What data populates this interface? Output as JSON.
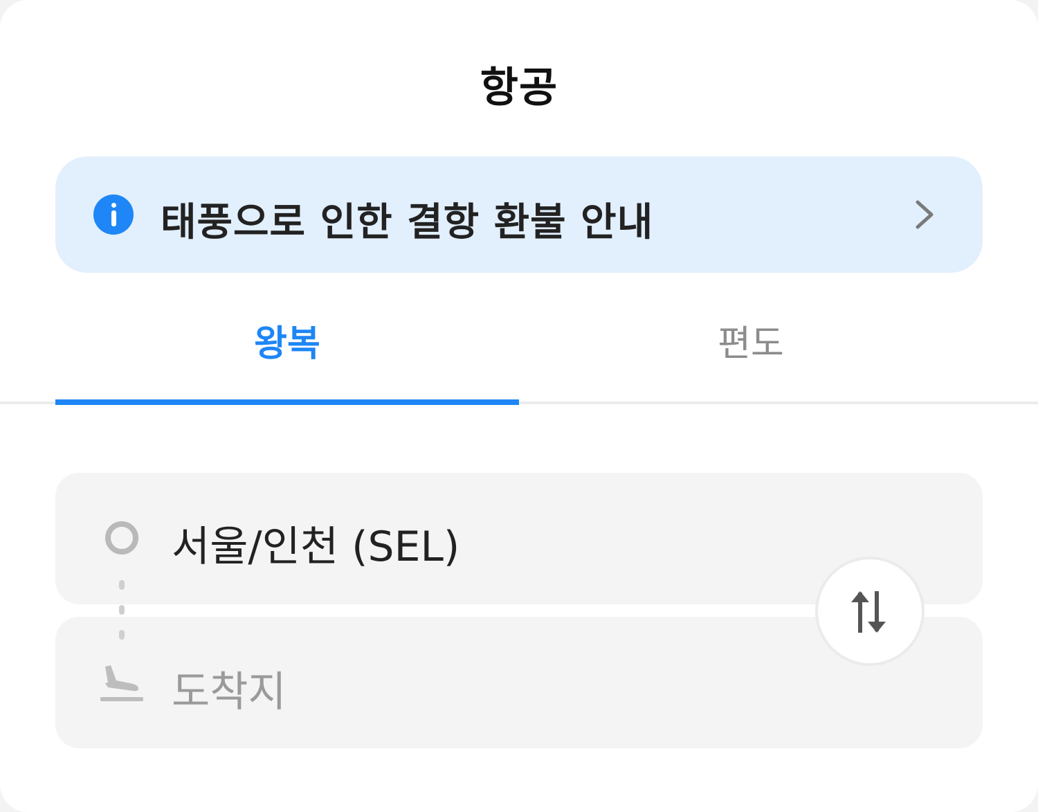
{
  "header": {
    "title": "항공"
  },
  "notice": {
    "text": "태풍으로 인한 결항 환불 안내",
    "icon": "info-icon",
    "accent_color": "#1e86f6",
    "background_color": "#e2effd"
  },
  "tabs": [
    {
      "label": "왕복",
      "active": true
    },
    {
      "label": "편도",
      "active": false
    }
  ],
  "route": {
    "origin": {
      "label": "서울/인천 (SEL)",
      "icon": "origin-dot-icon"
    },
    "destination": {
      "placeholder": "도착지",
      "icon": "plane-arrival-icon"
    },
    "swap_icon": "swap-arrows-icon"
  },
  "colors": {
    "active": "#1e86f6",
    "inactive_text": "#8c8c8c",
    "field_background": "#f4f4f4"
  }
}
